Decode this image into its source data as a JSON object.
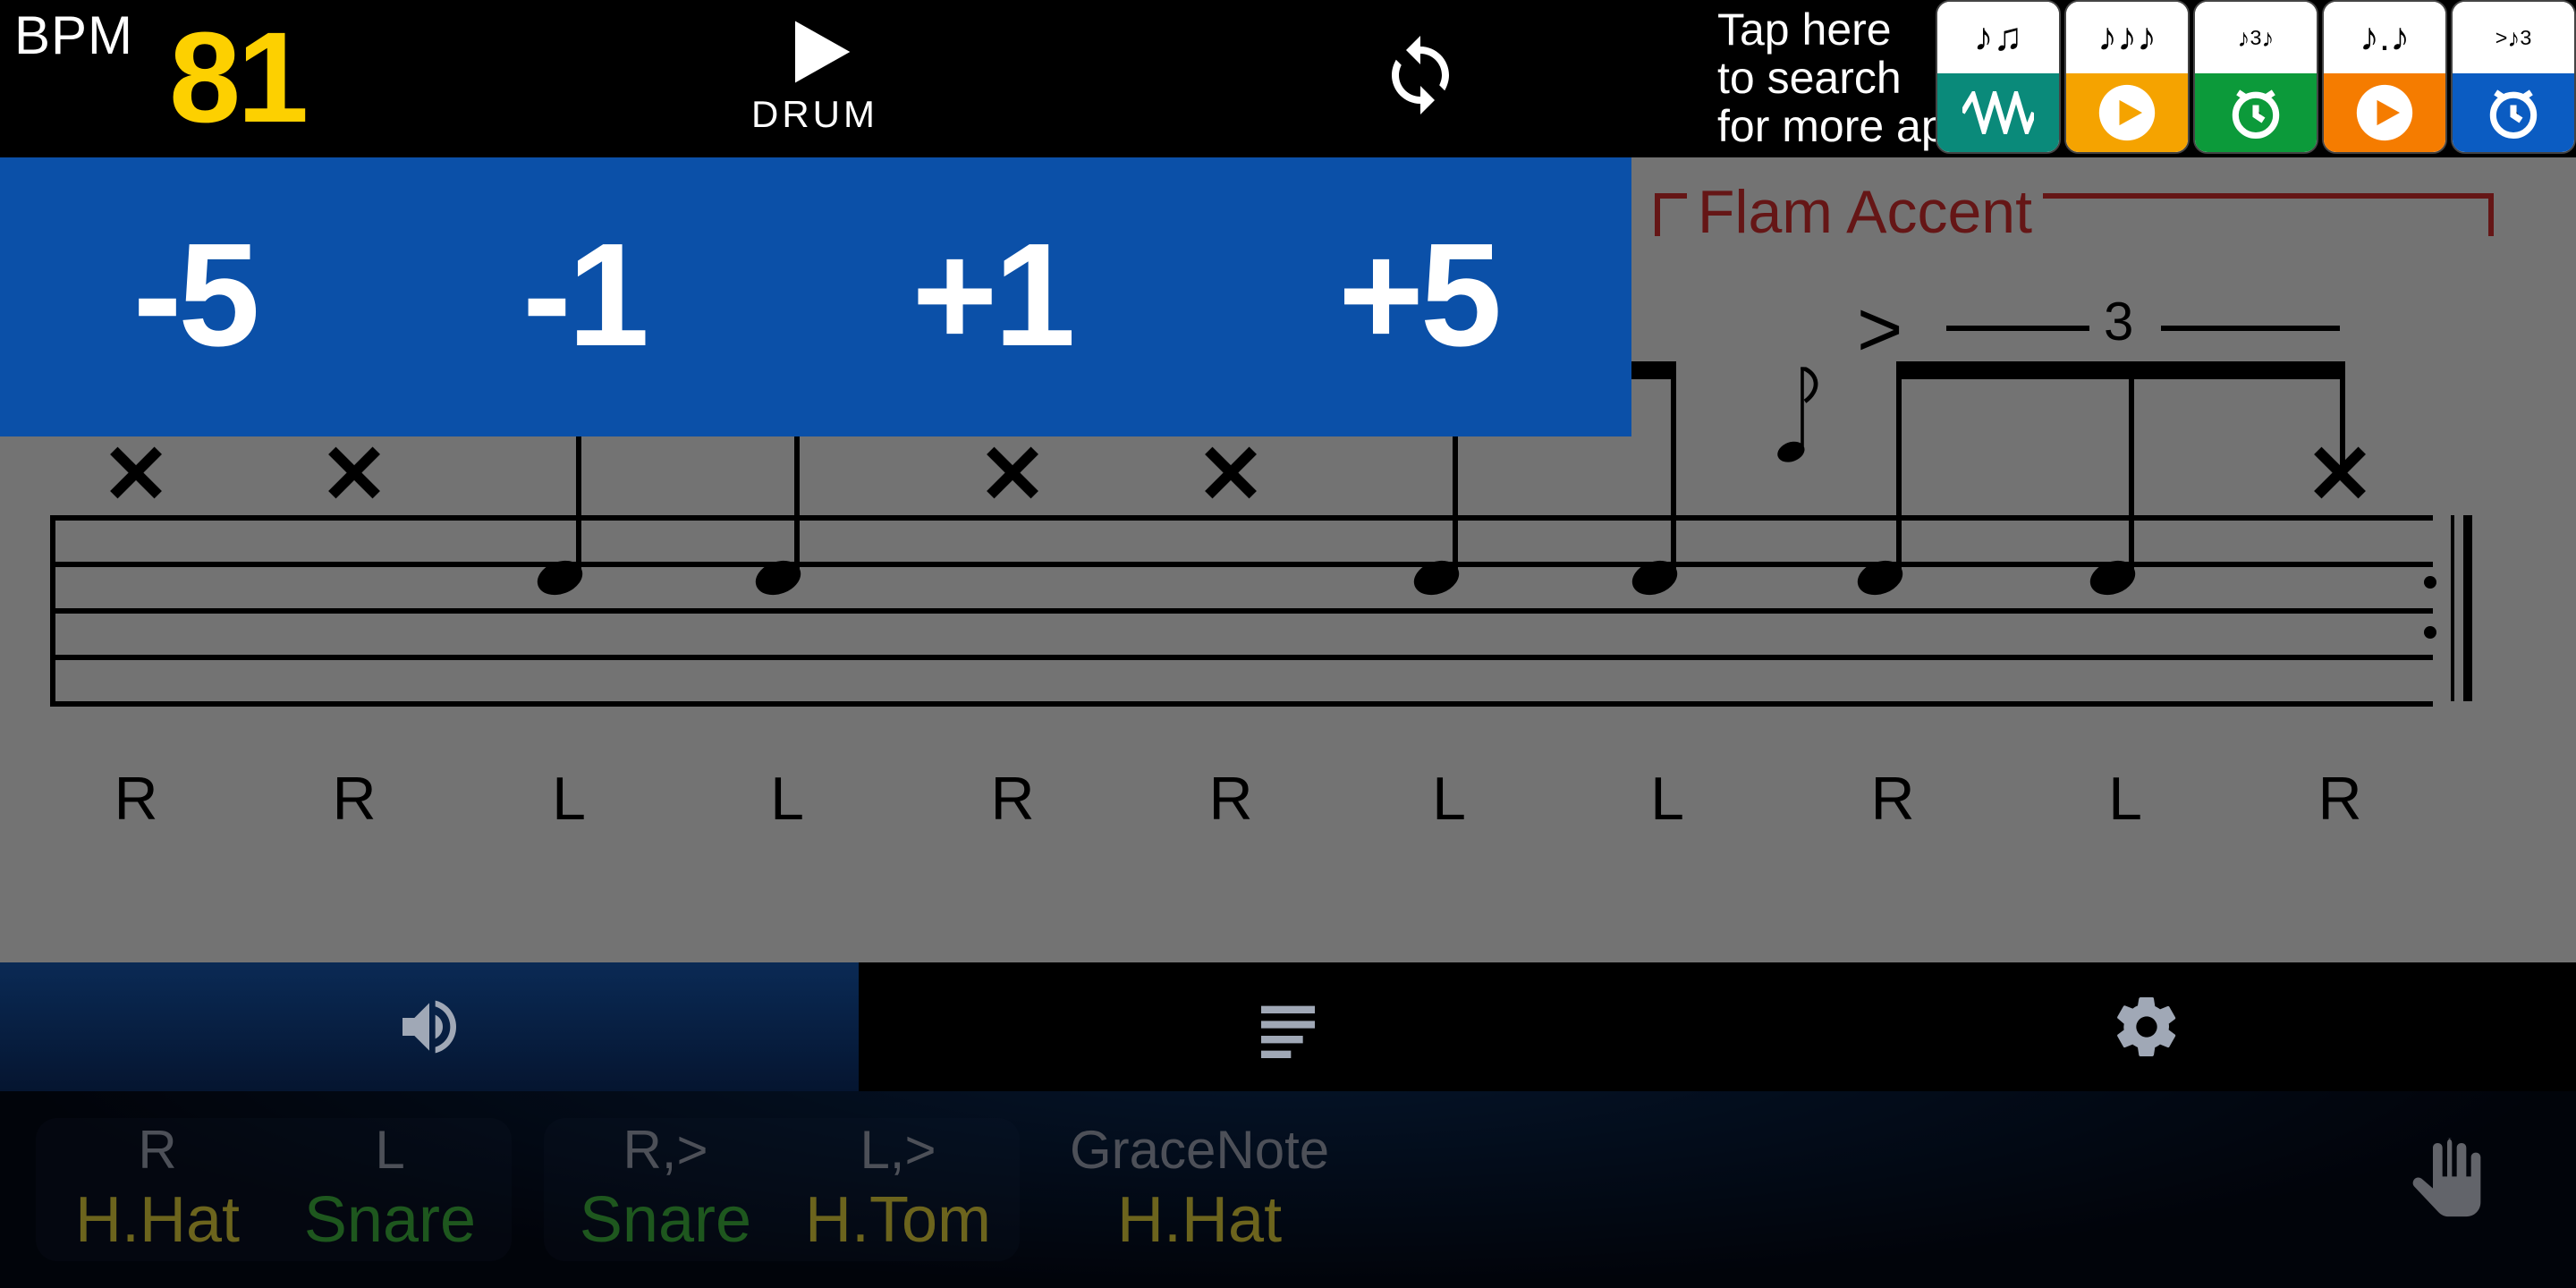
{
  "topbar": {
    "bpm_label": "BPM",
    "bpm_value": "81",
    "play_label": "DRUM",
    "promo_text": "Tap here\nto search\nfor more apps!"
  },
  "bpm_adjust": {
    "minus5": "-5",
    "minus1": "-1",
    "plus1": "+1",
    "plus5": "+5"
  },
  "score": {
    "title": "Flam Accent",
    "tuplet": "3",
    "accent": ">",
    "sticking": [
      "R",
      "R",
      "L",
      "L",
      "R",
      "R",
      "L",
      "L",
      "R",
      "L",
      "R"
    ]
  },
  "bottom": {
    "group1": [
      {
        "hand": "R",
        "inst": "H.Hat",
        "color": "yellow"
      },
      {
        "hand": "L",
        "inst": "Snare",
        "color": "green"
      }
    ],
    "group2": [
      {
        "hand": "R,>",
        "inst": "Snare",
        "color": "green"
      },
      {
        "hand": "L,>",
        "inst": "H.Tom",
        "color": "yellow"
      }
    ],
    "grace": {
      "label": "GraceNote",
      "inst": "H.Hat",
      "color": "yellow"
    }
  }
}
